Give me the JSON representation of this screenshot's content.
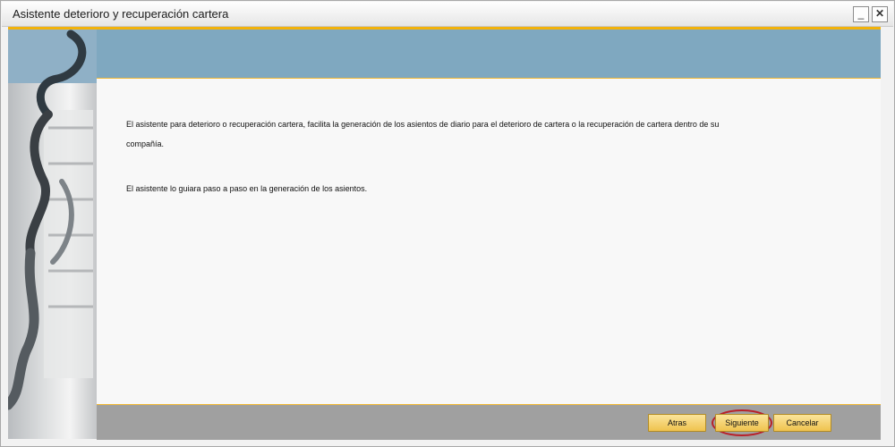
{
  "window": {
    "title": "Asistente deterioro y recuperación cartera",
    "minimize_glyph": "_",
    "close_glyph": "✕"
  },
  "content": {
    "paragraph1": "El asistente para deterioro o recuperación cartera, facilita la generación de los asientos de diario para el deterioro de cartera o la recuperación de cartera dentro de su compañía.",
    "paragraph2": "El asistente lo guiara paso a paso en la generación de los asientos."
  },
  "buttons": {
    "back": "Atras",
    "next": "Siguiente",
    "cancel": "Cancelar"
  },
  "colors": {
    "accent": "#f2b20a",
    "banner": "#7fa8c0",
    "bottom_bar": "#a0a0a0",
    "button_fill": "#efc24e",
    "highlight_ring": "#b8202a"
  },
  "icons": {
    "minimize": "minimize-icon",
    "close": "close-icon",
    "sidebar_art": "chain-link-graphic"
  }
}
